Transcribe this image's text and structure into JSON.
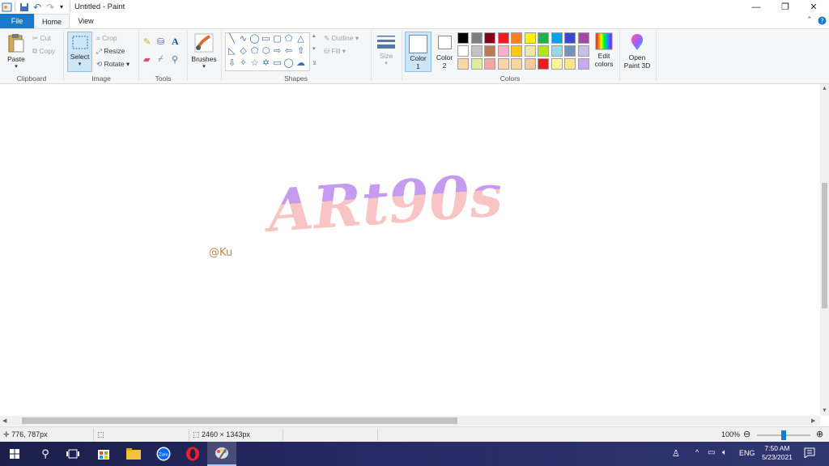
{
  "window": {
    "title": "Untitled - Paint",
    "minimize_glyph": "—",
    "restore_glyph": "❐",
    "close_glyph": "✕"
  },
  "tabs": [
    {
      "label": "File"
    },
    {
      "label": "Home"
    },
    {
      "label": "View"
    }
  ],
  "ribbon": {
    "clipboard": {
      "paste": "Paste",
      "cut": "Cut",
      "copy": "Copy",
      "group": "Clipboard"
    },
    "image": {
      "select": "Select",
      "crop": "Crop",
      "resize": "Resize",
      "rotate": "Rotate",
      "group": "Image"
    },
    "tools": {
      "group": "Tools"
    },
    "brushes": {
      "label": "Brushes"
    },
    "shapes": {
      "outline": "Outline",
      "fill": "Fill",
      "group": "Shapes"
    },
    "size": {
      "label": "Size"
    },
    "colors": {
      "color1_label": "Color",
      "color1_num": "1",
      "color2_label": "Color",
      "color2_num": "2",
      "edit_label": "Edit",
      "edit_label2": "colors",
      "group": "Colors",
      "row1": [
        "#000000",
        "#7f7f7f",
        "#880015",
        "#ed1c24",
        "#ff7f27",
        "#fff200",
        "#22b14c",
        "#00a2e8",
        "#3f48cc",
        "#a349a4"
      ],
      "row2": [
        "#ffffff",
        "#c3c3c3",
        "#b97a57",
        "#ffaec9",
        "#ffc90e",
        "#efe4b0",
        "#b5e61d",
        "#99d9ea",
        "#7092be",
        "#c8bfe7"
      ],
      "row3": [
        "#f9d8a5",
        "#e2eb9d",
        "#f7a4a4",
        "#fcd5a6",
        "#f9d3a0",
        "#f8c8a0",
        "#ed1c24",
        "#fff799",
        "#fde68a",
        "#c8a8f0"
      ]
    },
    "paint3d": {
      "label": "Open",
      "label2": "Paint 3D"
    }
  },
  "canvas": {
    "artwork_text": "ARt90s",
    "signature": "@Ku",
    "art_colors": {
      "top": "#c59bf0",
      "bottom": "#f8c4c4"
    }
  },
  "status": {
    "cursor_pos": "776, 787px",
    "image_size": "2460 × 1343px",
    "zoom": "100%",
    "zoom_fraction": 0.5
  },
  "taskbar": {
    "time": "7:50 AM",
    "date": "5/23/2021",
    "lang": "ENG",
    "apps": [
      "start-icon",
      "search-icon",
      "task-view-icon",
      "store-icon",
      "file-explorer-icon",
      "zalo-icon",
      "opera-icon",
      "paint-icon"
    ],
    "zalo_label": "Zalo"
  }
}
